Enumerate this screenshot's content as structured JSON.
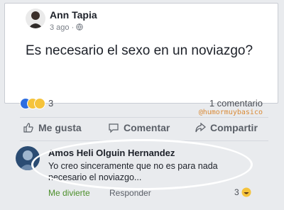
{
  "post": {
    "author": "Ann Tapia",
    "time": "3 ago",
    "privacy_icon": "globe-icon",
    "text": "Es necesario el sexo en un noviazgo?",
    "reaction_count": "3",
    "comments_count": "1 comentario",
    "watermark": "@humormuybasico"
  },
  "actions": {
    "like": "Me gusta",
    "comment": "Comentar",
    "share": "Compartir"
  },
  "comment": {
    "author": "Amos Heli Olguin Hernandez",
    "text": "Yo creo sinceramente que no es para nada necesario el noviazgo...",
    "funny_label": "Me divierte",
    "reply_label": "Responder",
    "reaction_count": "3"
  },
  "colors": {
    "background": "#e9ebee",
    "text": "#1d2129",
    "muted": "#5a5f67",
    "watermark": "#d98a36",
    "funny_green": "#4c8f2b",
    "like_blue": "#2e6ee0",
    "emoji_yellow": "#f5c33b"
  }
}
